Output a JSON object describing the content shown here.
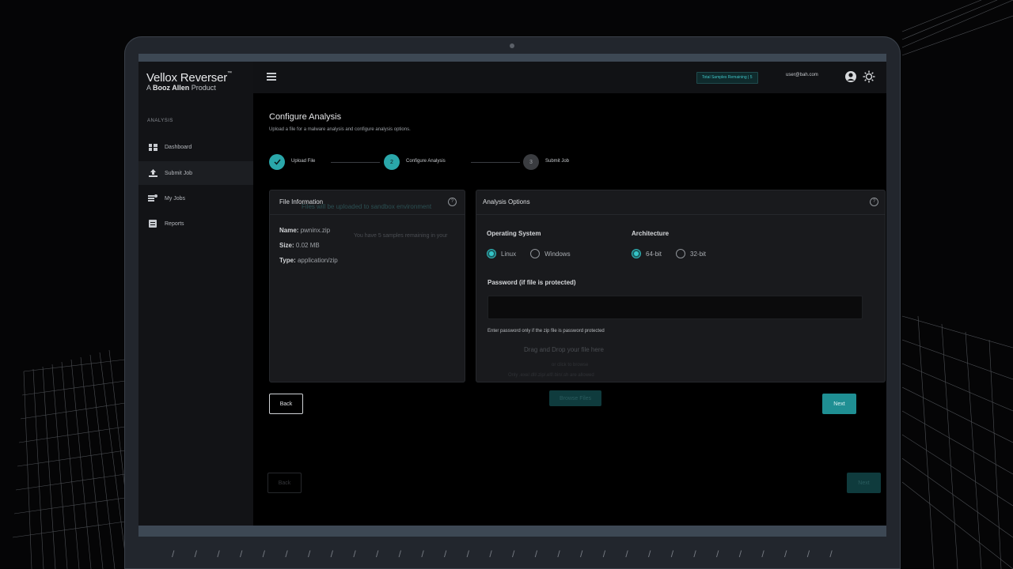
{
  "brand": {
    "name": "Vellox Reverser",
    "tm": "™",
    "sub_prefix": "A",
    "sub_company": "Booz Allen",
    "sub_suffix": "Product"
  },
  "sidebar": {
    "section_label": "ANALYSIS",
    "items": [
      {
        "label": "Dashboard",
        "icon": "dashboard-icon"
      },
      {
        "label": "Submit Job",
        "icon": "upload-icon",
        "active": true
      },
      {
        "label": "My Jobs",
        "icon": "jobs-icon"
      },
      {
        "label": "Reports",
        "icon": "reports-icon"
      }
    ]
  },
  "header": {
    "samples_badge": "Total Samples Remaining | 5",
    "user_email": "user@bah.com"
  },
  "page": {
    "title": "Configure Analysis",
    "subtitle": "Upload a file for a malware analysis and configure analysis options."
  },
  "stepper": [
    {
      "number": "✓",
      "label": "Upload File",
      "state": "done"
    },
    {
      "number": "2",
      "label": "Configure Analysis",
      "state": "active"
    },
    {
      "number": "3",
      "label": "Submit Job",
      "state": "pending"
    }
  ],
  "file_info": {
    "title": "File Information",
    "name_label": "Name:",
    "name_value": "pwninx.zip",
    "size_label": "Size:",
    "size_value": "0.02 MB",
    "type_label": "Type:",
    "type_value": "application/zip"
  },
  "analysis_options": {
    "title": "Analysis Options",
    "os_label": "Operating System",
    "os_options": [
      "Linux",
      "Windows"
    ],
    "os_selected": "Linux",
    "arch_label": "Architecture",
    "arch_options": [
      "64-bit",
      "32-bit"
    ],
    "arch_selected": "64-bit",
    "password_label": "Password (if file is protected)",
    "password_value": "",
    "password_hint": "Enter password only if the zip file is password protected"
  },
  "ghost": {
    "upload_note": "Files will be uploaded to sandbox environment",
    "samples_note": "You have 5 samples remaining in your",
    "drop_title": "Drag and Drop your file here",
    "drop_or": "or click to browse",
    "drop_types": "Only .exe/.dll/.zip/.elf/.bin/.sh are allowed",
    "browse": "Browse Files",
    "back": "Back",
    "next": "Next"
  },
  "buttons": {
    "back": "Back",
    "next": "Next"
  },
  "colors": {
    "accent": "#1f8f93",
    "accent_bright": "#35c5c8",
    "background": "#000000",
    "card": "#191a1d"
  }
}
